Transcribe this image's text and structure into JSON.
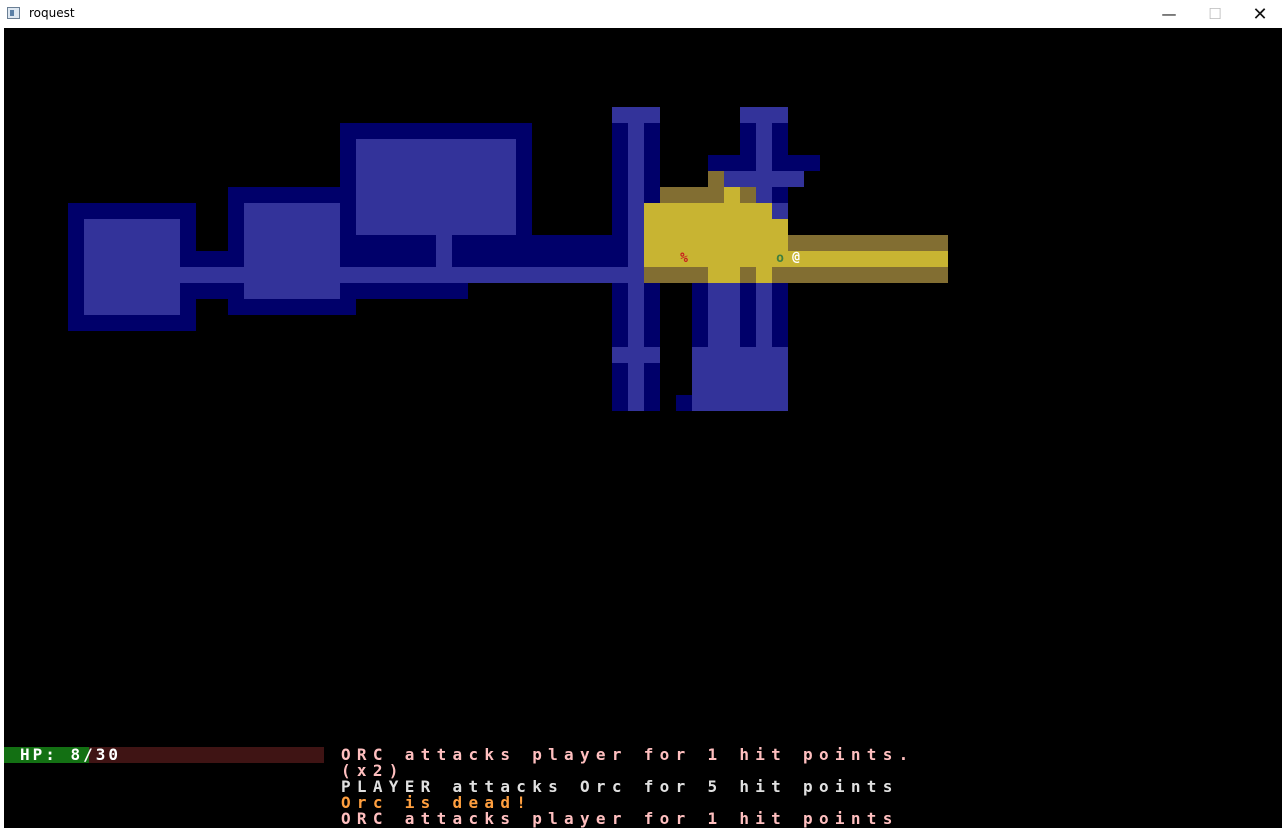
{
  "window": {
    "title": "roquest",
    "minimize_glyph": "—",
    "maximize_glyph": "☐",
    "close_glyph": "✕"
  },
  "map": {
    "explored_floor_color": "#33339a",
    "explored_wall_color": "#00006a",
    "lit_floor_color": "#c8b432",
    "lit_wall_color": "#826e32",
    "entities": [
      {
        "name": "corpse",
        "glyph": "%",
        "color": "#c81e1e"
      },
      {
        "name": "orc",
        "glyph": "o",
        "color": "#3f7f3f"
      },
      {
        "name": "player",
        "glyph": "@",
        "color": "#ffffff"
      }
    ]
  },
  "status": {
    "hp_label": "HP: 8/30",
    "hp_current": 8,
    "hp_max": 30,
    "bar_fill_color": "#137013",
    "bar_empty_color": "#3f1414"
  },
  "log": [
    {
      "text": "ORC attacks player for 1 hit points.",
      "color": "#ffbfbf"
    },
    {
      "text": "(x2)",
      "color": "#ffbfbf"
    },
    {
      "text": "PLAYER attacks Orc for 5 hit points",
      "color": "#e0e0e0"
    },
    {
      "text": "Orc is dead!",
      "color": "#ff9f3f"
    },
    {
      "text": "ORC attacks player for 1 hit points",
      "color": "#ffbfbf"
    }
  ]
}
